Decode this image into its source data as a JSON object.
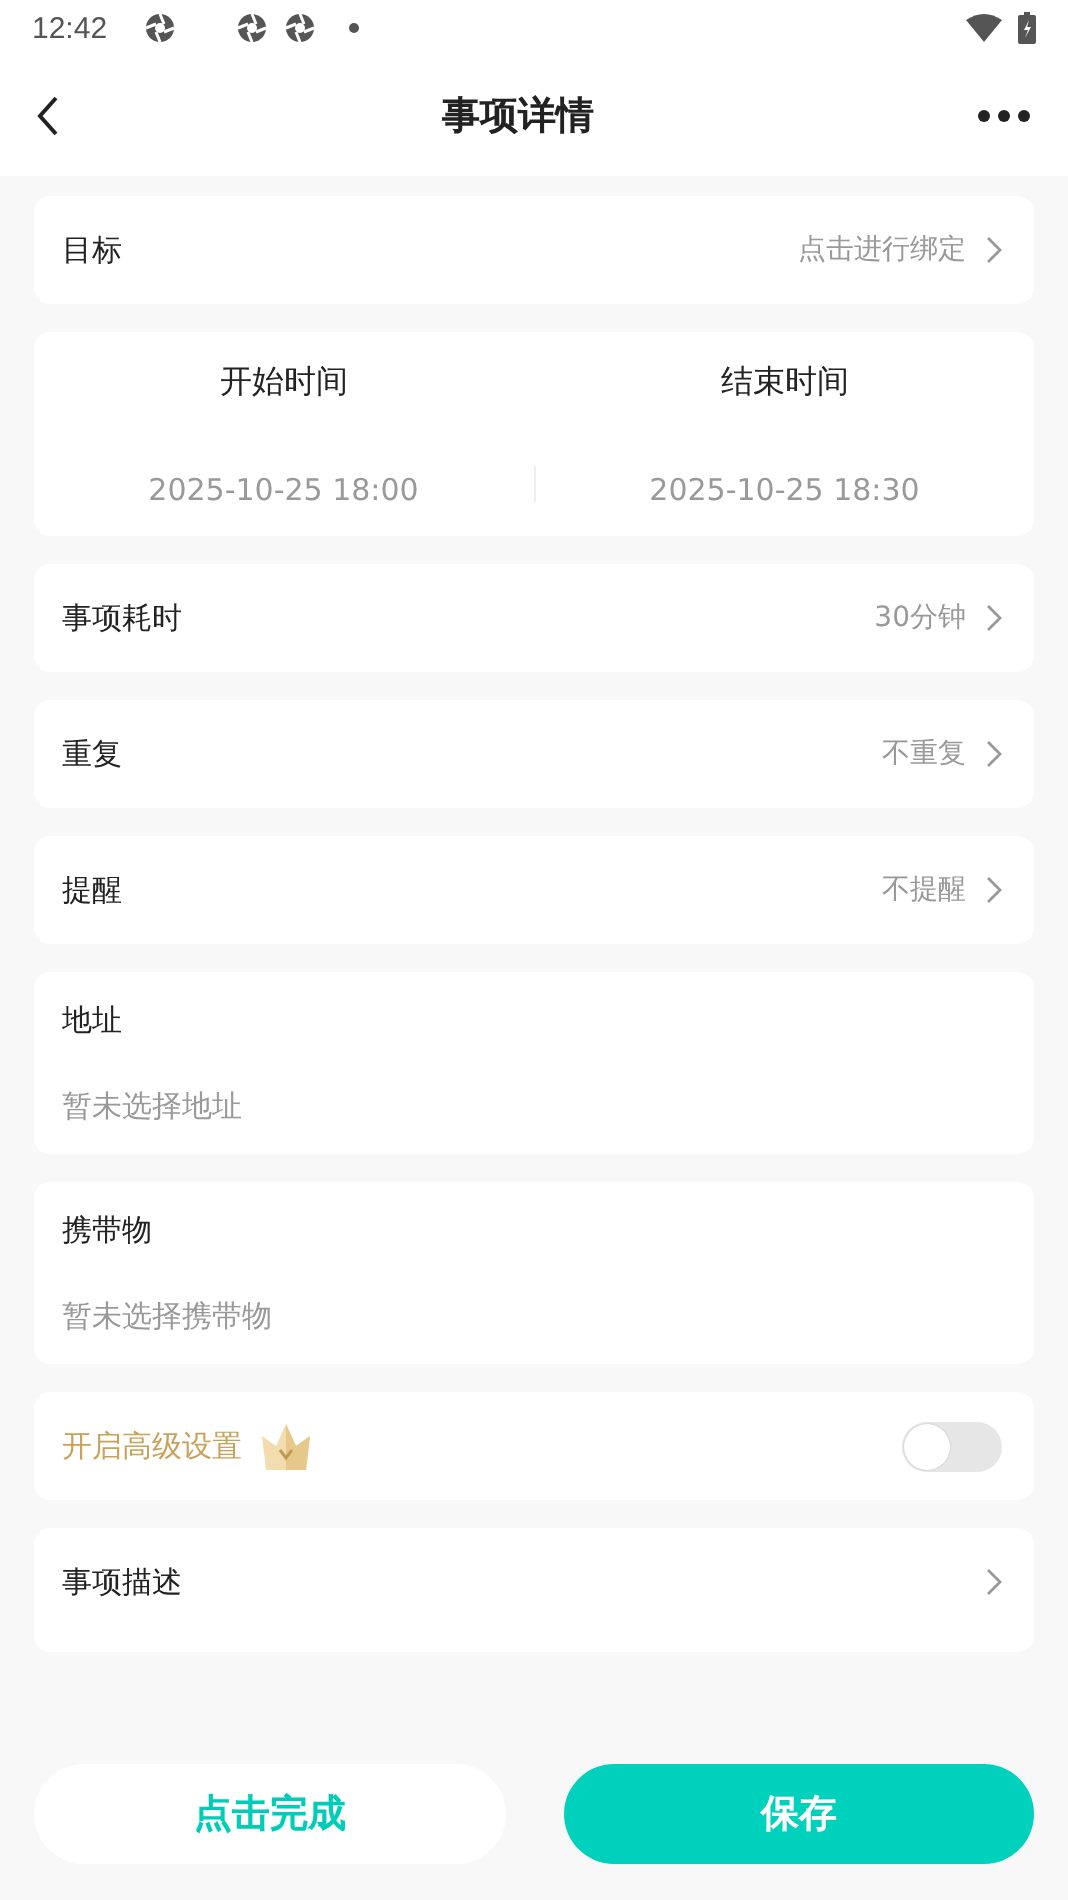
{
  "status_bar": {
    "time": "12:42"
  },
  "header": {
    "title": "事项详情"
  },
  "cards": [
    {
      "kind": "link",
      "label": "目标",
      "value": "点击进行绑定"
    },
    {
      "kind": "times",
      "start_label": "开始时间",
      "start_value": "2025-10-25 18:00",
      "end_label": "结束时间",
      "end_value": "2025-10-25 18:30"
    },
    {
      "kind": "link",
      "label": "事项耗时",
      "value": "30分钟"
    },
    {
      "kind": "link",
      "label": "重复",
      "value": "不重复"
    },
    {
      "kind": "link",
      "label": "提醒",
      "value": "不提醒"
    },
    {
      "kind": "field",
      "label": "地址",
      "placeholder": "暂未选择地址"
    },
    {
      "kind": "field",
      "label": "携带物",
      "placeholder": "暂未选择携带物"
    },
    {
      "kind": "toggle",
      "label": "开启高级设置",
      "on": false
    },
    {
      "kind": "description",
      "label": "事项描述"
    }
  ],
  "buttons": [
    {
      "kind": "secondary",
      "label": "点击完成"
    },
    {
      "kind": "primary",
      "label": "保存"
    }
  ]
}
